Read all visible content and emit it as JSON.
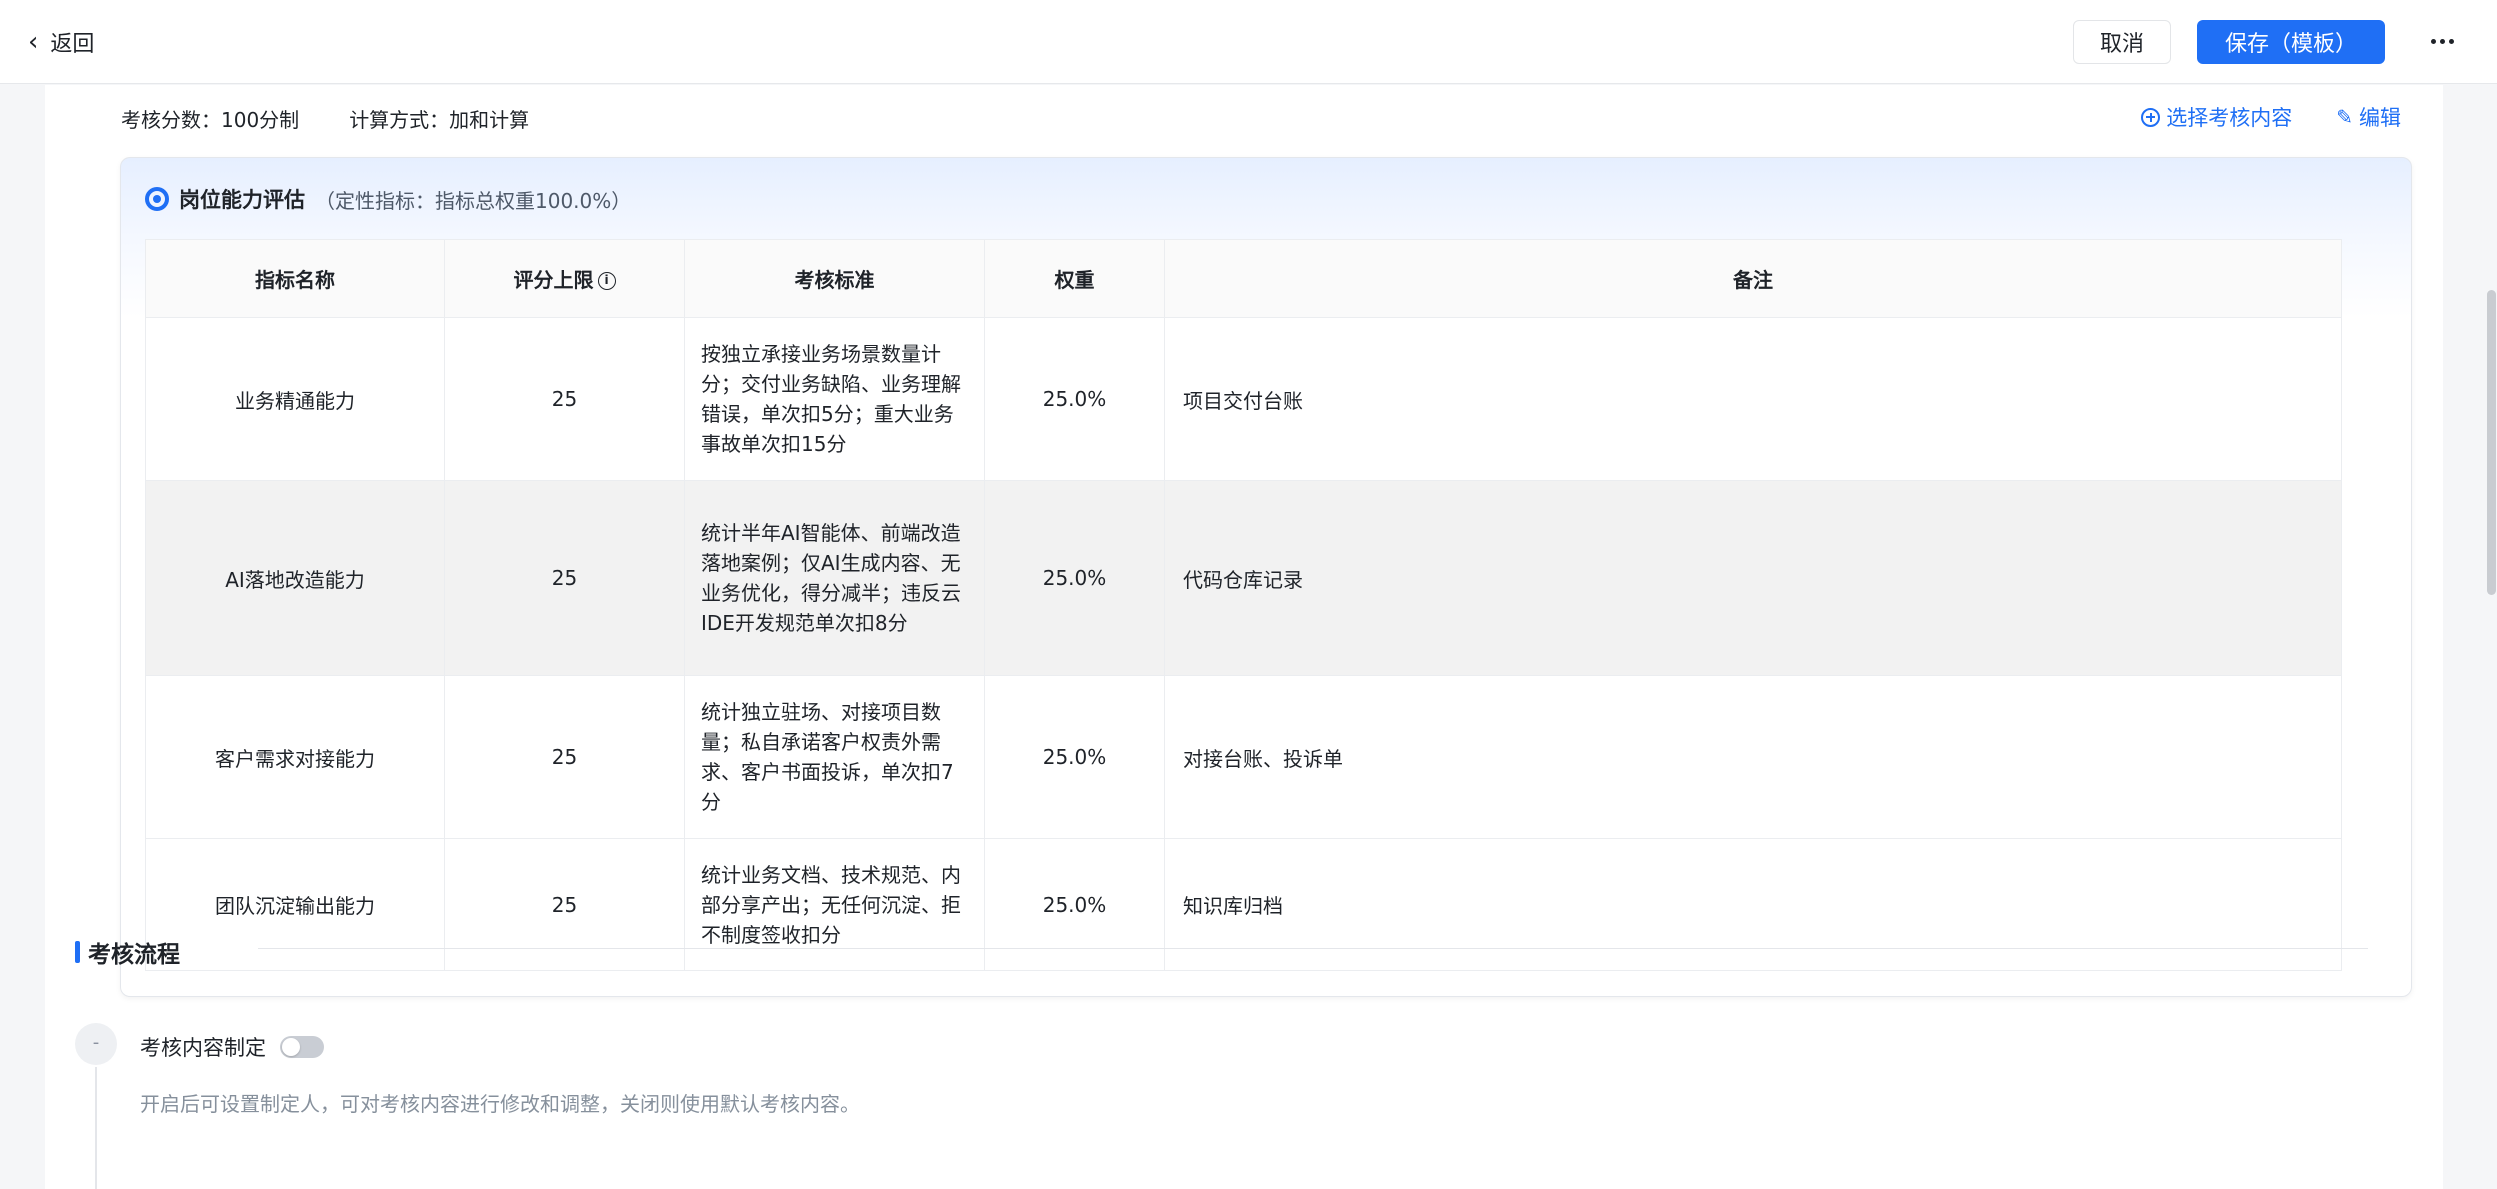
{
  "header": {
    "back_label": "返回",
    "cancel_label": "取消",
    "save_label": "保存（模板）"
  },
  "meta": {
    "score_system": "考核分数：100分制",
    "calc_method": "计算方式：加和计算",
    "select_content_label": "选择考核内容",
    "edit_label": "编辑"
  },
  "section": {
    "title": "岗位能力评估",
    "subtitle": "（定性指标：指标总权重100.0%）",
    "columns": [
      "指标名称",
      "评分上限",
      "考核标准",
      "权重",
      "备注"
    ],
    "rows": [
      {
        "name": "业务精通能力",
        "max": "25",
        "standard": "按独立承接业务场景数量计分；交付业务缺陷、业务理解错误，单次扣5分；重大业务事故单次扣15分",
        "weight": "25.0%",
        "note": "项目交付台账"
      },
      {
        "name": "AI落地改造能力",
        "max": "25",
        "standard": "统计半年AI智能体、前端改造落地案例；仅AI生成内容、无业务优化，得分减半；违反云IDE开发规范单次扣8分",
        "weight": "25.0%",
        "note": "代码仓库记录"
      },
      {
        "name": "客户需求对接能力",
        "max": "25",
        "standard": "统计独立驻场、对接项目数量；私自承诺客户权责外需求、客户书面投诉，单次扣7分",
        "weight": "25.0%",
        "note": "对接台账、投诉单"
      },
      {
        "name": "团队沉淀输出能力",
        "max": "25",
        "standard": "统计业务文档、技术规范、内部分享产出；无任何沉淀、拒不制度签收扣分",
        "weight": "25.0%",
        "note": "知识库归档"
      }
    ]
  },
  "process": {
    "title": "考核流程",
    "step_marker": "-",
    "step_label": "考核内容制定",
    "step_toggle_on": false,
    "step_desc": "开启后可设置制定人，可对考核内容进行修改和调整，关闭则使用默认考核内容。"
  },
  "colors": {
    "primary": "#1f6ff5",
    "row_highlight": "#f2f2f2"
  }
}
